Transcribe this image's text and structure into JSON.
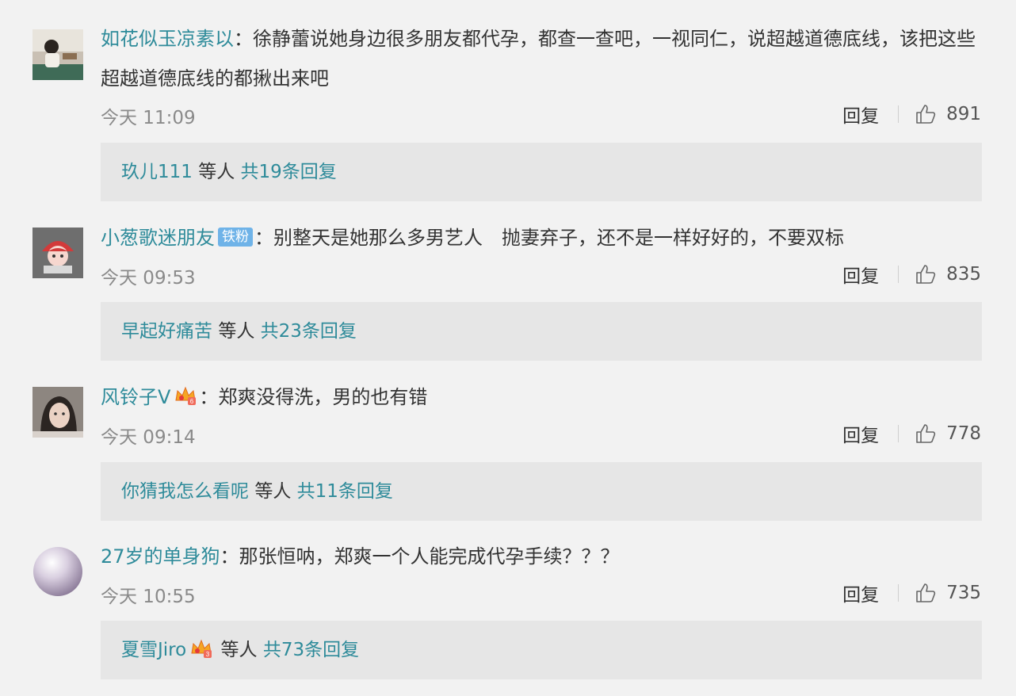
{
  "comments": [
    {
      "username": "如花似玉凉素以",
      "colon": "：",
      "text": "徐静蕾说她身边很多朋友都代孕，都查一查吧，一视同仁，说超越道德底线，该把这些超越道德底线的都揪出来吧",
      "time": "今天 11:09",
      "reply_label": "回复",
      "likes": "891",
      "replies_user": "玖儿111",
      "replies_mid": "等人",
      "replies_total": "共19条回复",
      "avatar_icon": "avatar-photo-woman-icon"
    },
    {
      "username": "小葱歌迷朋友",
      "badge": "铁粉",
      "colon": "：",
      "text": "别整天是她那么多男艺人　抛妻弃子，还不是一样好好的，不要双标",
      "time": "今天 09:53",
      "reply_label": "回复",
      "likes": "835",
      "replies_user": "早起好痛苦",
      "replies_mid": "等人",
      "replies_total": "共23条回复",
      "avatar_icon": "avatar-cartoon-icon"
    },
    {
      "username": "风铃子V",
      "colon": "：",
      "text": "郑爽没得洗，男的也有错",
      "time": "今天 09:14",
      "reply_label": "回复",
      "likes": "778",
      "replies_user": "你猜我怎么看呢",
      "replies_mid": "等人",
      "replies_total": "共11条回复",
      "avatar_icon": "avatar-photo-girl-icon"
    },
    {
      "username": "27岁的单身狗",
      "colon": "：",
      "text": "那张恒呐，郑爽一个人能完成代孕手续？？？",
      "time": "今天 10:55",
      "reply_label": "回复",
      "likes": "735",
      "replies_user": "夏雪Jiro",
      "replies_mid": "等人",
      "replies_total": "共73条回复",
      "avatar_icon": "avatar-pearl-icon"
    }
  ],
  "colors": {
    "username": "#2e8b9a",
    "text": "#333333",
    "meta": "#8a8a8a",
    "reply_box_bg": "#e6e6e6",
    "background": "#f2f2f2",
    "badge_bg": "#6fb3e8"
  }
}
